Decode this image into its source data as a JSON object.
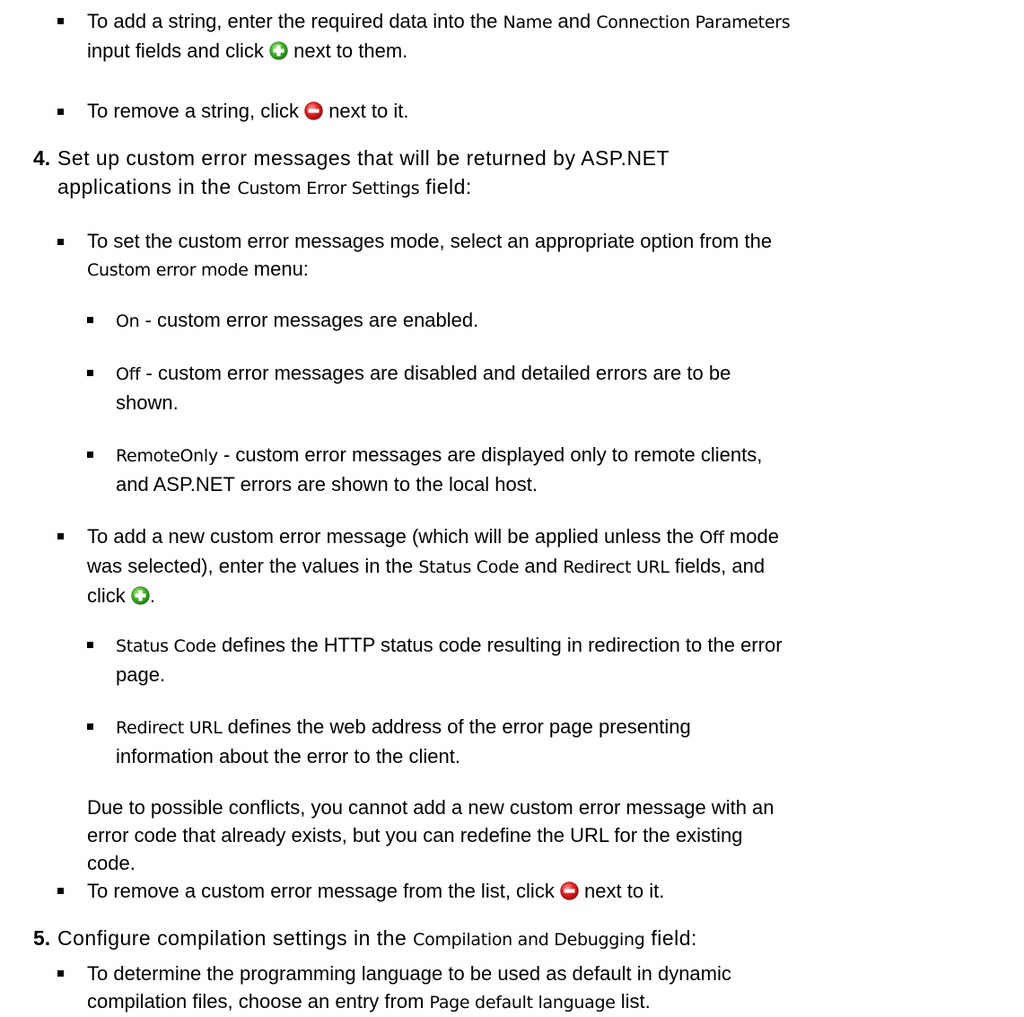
{
  "step3": {
    "add_string": {
      "p1": "To add a string, enter the required data into the ",
      "ui1": "Name",
      "p2": " and ",
      "ui2": "Connection Parameters",
      "p3": "input fields and click ",
      "p4": " next to them."
    },
    "remove_string": {
      "p1": "To remove a string, click ",
      "p2": " next to it."
    }
  },
  "step4": {
    "number": "4.",
    "p1": "Set up custom error messages that will be returned by ASP.NET",
    "p2": "applications in the ",
    "ui1": "Custom Error Settings",
    "p3": " field:",
    "mode": {
      "p1": "To set the custom error messages mode, select an appropriate option from the",
      "ui1": "Custom error mode",
      "p2": " menu:"
    },
    "options": [
      {
        "name": "On",
        "text": " - custom error messages are enabled."
      },
      {
        "name": "Off",
        "text": " - custom error messages are disabled and detailed errors are to be",
        "text2": "shown."
      },
      {
        "name": "RemoteOnly",
        "text": " - custom error messages are displayed only to remote clients,",
        "text2": "and ASP.NET errors are shown to the local host."
      }
    ],
    "add_msg": {
      "p1": "To add a new custom error message (which will be applied unless the ",
      "ui1": "Off",
      "p2": " mode",
      "p3": "was selected), enter the values in the ",
      "ui2": "Status Code",
      "p4": " and ",
      "ui3": "Redirect URL",
      "p5": " fields, and",
      "p6": "click ",
      "p7": "."
    },
    "fields": [
      {
        "name": "Status Code",
        "text": " defines the HTTP status code resulting in redirection to the error",
        "text2": "page."
      },
      {
        "name": "Redirect URL",
        "text": " defines the web address of the error page presenting",
        "text2": "information about the error to the client."
      }
    ],
    "note": [
      "Due to possible conflicts, you cannot add a new custom error message with an",
      "error code that already exists, but you can redefine the URL for the existing",
      "code."
    ],
    "remove_msg": {
      "p1": "To remove a custom error message from the list, click ",
      "p2": " next to it."
    }
  },
  "step5": {
    "number": "5.",
    "p1": "Configure compilation settings in the ",
    "ui1": "Compilation and Debugging",
    "p2": " field:",
    "lang": {
      "p1": "To determine the programming language to be used as default in dynamic",
      "p2": "compilation files, choose an entry from ",
      "ui1": "Page default language",
      "p3": " list."
    }
  },
  "icons": {
    "add": "plus-icon",
    "remove": "minus-icon",
    "add_color": "#33aa22",
    "remove_color": "#dd1111"
  }
}
